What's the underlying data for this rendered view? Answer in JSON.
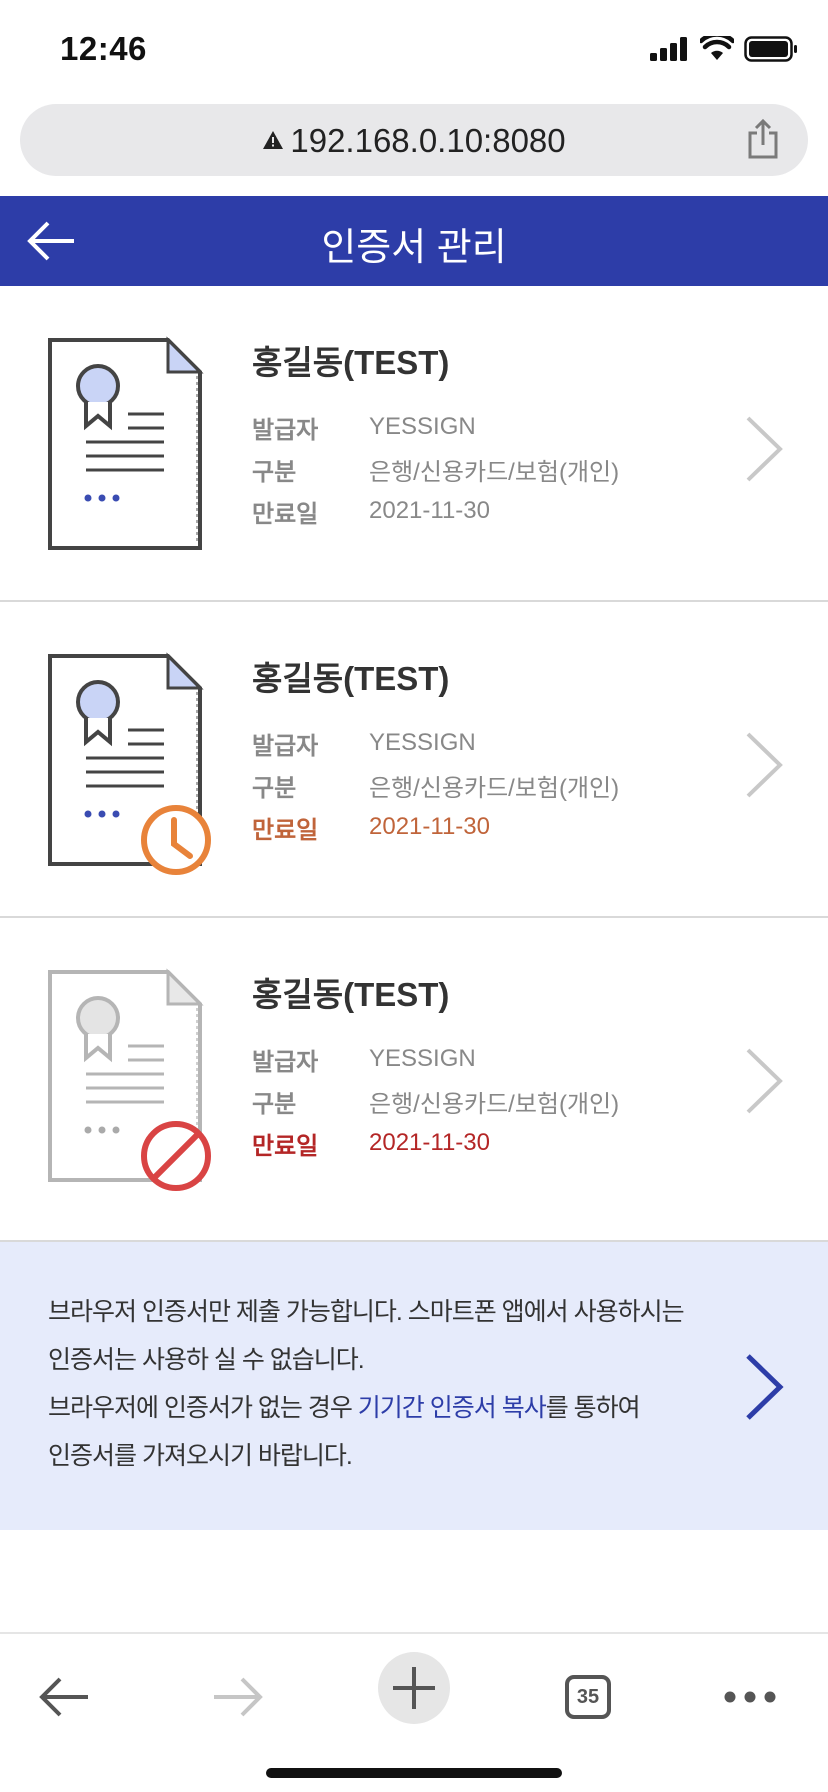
{
  "status": {
    "time": "12:46"
  },
  "browser": {
    "url": "192.168.0.10:8080",
    "tab_count": "35"
  },
  "header": {
    "title": "인증서 관리"
  },
  "labels": {
    "issuer": "발급자",
    "category": "구분",
    "expiry": "만료일"
  },
  "certificates": [
    {
      "name": "홍길동(TEST)",
      "issuer": "YESSIGN",
      "category": "은행/신용카드/보험(개인)",
      "expiry": "2021-11-30",
      "state": "valid"
    },
    {
      "name": "홍길동(TEST)",
      "issuer": "YESSIGN",
      "category": "은행/신용카드/보험(개인)",
      "expiry": "2021-11-30",
      "state": "expiring"
    },
    {
      "name": "홍길동(TEST)",
      "issuer": "YESSIGN",
      "category": "은행/신용카드/보험(개인)",
      "expiry": "2021-11-30",
      "state": "expired"
    }
  ],
  "notice": {
    "line1": "브라우저 인증서만 제출 가능합니다. 스마트폰 앱에서 사용하시는",
    "line2": "인증서는 사용하 실 수 없습니다.",
    "line3_prefix": "브라우저에 인증서가 없는 경우 ",
    "line3_link": "기기간 인증서 복사",
    "line3_suffix": "를 통하여",
    "line4": "인증서를 가져오시기 바랍니다."
  },
  "colors": {
    "brand": "#2d3da8",
    "warning": "#e8833a",
    "danger": "#d94444",
    "notice_bg": "#e6ebfb"
  }
}
